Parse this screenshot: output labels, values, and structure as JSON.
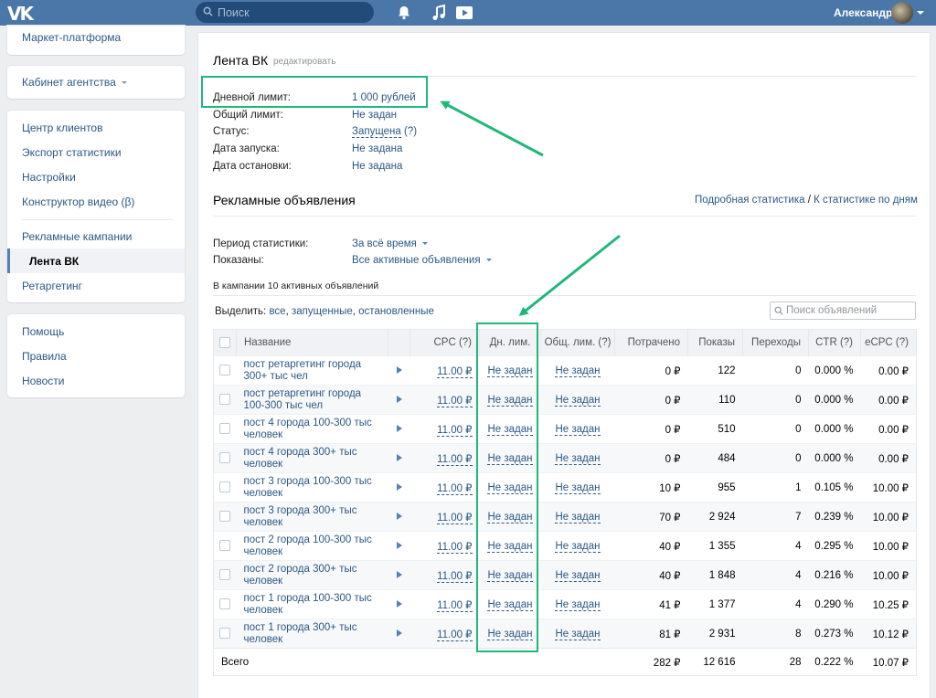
{
  "topbar": {
    "logo": "VK",
    "search_placeholder": "Поиск",
    "user_name": "Александр"
  },
  "sidebar": {
    "block1": [
      {
        "label": "Маркет-платформа"
      }
    ],
    "block2": [
      {
        "label": "Кабинет агентства"
      }
    ],
    "block3": [
      {
        "label": "Центр клиентов"
      },
      {
        "label": "Экспорт статистики"
      },
      {
        "label": "Настройки"
      },
      {
        "label": "Конструктор видео (β)"
      },
      {
        "label": "Рекламные кампании"
      },
      {
        "label": "Лента ВК",
        "active": true
      },
      {
        "label": "Ретаргетинг"
      }
    ],
    "block4": [
      {
        "label": "Помощь"
      },
      {
        "label": "Правила"
      },
      {
        "label": "Новости"
      }
    ]
  },
  "campaign": {
    "title": "Лента ВК",
    "edit_label": "редактировать",
    "fields": [
      {
        "label": "Дневной лимит:",
        "value": "1 000 рублей"
      },
      {
        "label": "Общий лимит:",
        "value": "Не задан"
      },
      {
        "label": "Статус:",
        "value": "Запущена",
        "extra": "(?)"
      },
      {
        "label": "Дата запуска:",
        "value": "Не задана"
      },
      {
        "label": "Дата остановки:",
        "value": "Не задана"
      }
    ]
  },
  "ads": {
    "title": "Рекламные объявления",
    "link_detailed": "Подробная статистика",
    "link_separator": "/",
    "link_by_day": "К статистике по дням",
    "period_label": "Период статистики:",
    "period_value": "За всё время",
    "shown_label": "Показаны:",
    "shown_value": "Все активные объявления",
    "active_count_text": "В кампании 10 активных объявлений",
    "select_label": "Выделить:",
    "select_all": "все",
    "select_running": "запущенные",
    "select_stopped": "остановленные",
    "select_sep": ",",
    "search_placeholder": "Поиск объявлений"
  },
  "table": {
    "headers": {
      "name": "Название",
      "cpc": "CPC (?)",
      "daily_limit": "Дн. лим.",
      "total_limit": "Общ. лим. (?)",
      "spent": "Потрачено",
      "impressions": "Показы",
      "clicks": "Переходы",
      "ctr": "CTR (?)",
      "ecpc": "eCPC (?)"
    },
    "rows": [
      {
        "name": "пост ретаргетинг города 300+ тыс чел",
        "cpc": "11.00 ₽",
        "daily": "Не задан",
        "total": "Не задан",
        "spent": "0 ₽",
        "impressions": "122",
        "clicks": "0",
        "ctr": "0.000 %",
        "ecpc": "0.00 ₽"
      },
      {
        "name": "пост ретаргетинг города 100-300 тыс чел",
        "cpc": "11.00 ₽",
        "daily": "Не задан",
        "total": "Не задан",
        "spent": "0 ₽",
        "impressions": "110",
        "clicks": "0",
        "ctr": "0.000 %",
        "ecpc": "0.00 ₽"
      },
      {
        "name": "пост 4 города 100-300 тыс человек",
        "cpc": "11.00 ₽",
        "daily": "Не задан",
        "total": "Не задан",
        "spent": "0 ₽",
        "impressions": "510",
        "clicks": "0",
        "ctr": "0.000 %",
        "ecpc": "0.00 ₽"
      },
      {
        "name": "пост 4 города 300+ тыс человек",
        "cpc": "11.00 ₽",
        "daily": "Не задан",
        "total": "Не задан",
        "spent": "0 ₽",
        "impressions": "484",
        "clicks": "0",
        "ctr": "0.000 %",
        "ecpc": "0.00 ₽"
      },
      {
        "name": "пост 3 города 100-300 тыс человек",
        "cpc": "11.00 ₽",
        "daily": "Не задан",
        "total": "Не задан",
        "spent": "10 ₽",
        "impressions": "955",
        "clicks": "1",
        "ctr": "0.105 %",
        "ecpc": "10.00 ₽"
      },
      {
        "name": "пост 3 города 300+ тыс человек",
        "cpc": "11.00 ₽",
        "daily": "Не задан",
        "total": "Не задан",
        "spent": "70 ₽",
        "impressions": "2 924",
        "clicks": "7",
        "ctr": "0.239 %",
        "ecpc": "10.00 ₽"
      },
      {
        "name": "пост 2 города 100-300 тыс человек",
        "cpc": "11.00 ₽",
        "daily": "Не задан",
        "total": "Не задан",
        "spent": "40 ₽",
        "impressions": "1 355",
        "clicks": "4",
        "ctr": "0.295 %",
        "ecpc": "10.00 ₽"
      },
      {
        "name": "пост 2 города 300+ тыс человек",
        "cpc": "11.00 ₽",
        "daily": "Не задан",
        "total": "Не задан",
        "spent": "40 ₽",
        "impressions": "1 848",
        "clicks": "4",
        "ctr": "0.216 %",
        "ecpc": "10.00 ₽"
      },
      {
        "name": "пост 1 города 100-300 тыс человек",
        "cpc": "11.00 ₽",
        "daily": "Не задан",
        "total": "Не задан",
        "spent": "41 ₽",
        "impressions": "1 377",
        "clicks": "4",
        "ctr": "0.290 %",
        "ecpc": "10.25 ₽"
      },
      {
        "name": "пост 1 города 300+ тыс человек",
        "cpc": "11.00 ₽",
        "daily": "Не задан",
        "total": "Не задан",
        "spent": "81 ₽",
        "impressions": "2 931",
        "clicks": "8",
        "ctr": "0.273 %",
        "ecpc": "10.12 ₽"
      }
    ],
    "total": {
      "label": "Всего",
      "spent": "282 ₽",
      "impressions": "12 616",
      "clicks": "28",
      "ctr": "0.222 %",
      "ecpc": "10.07 ₽"
    }
  },
  "annotations": {
    "color": "#1fb87a"
  },
  "colors": {
    "header": "#4a76a8",
    "link": "#2a5885",
    "background": "#edeef0"
  }
}
